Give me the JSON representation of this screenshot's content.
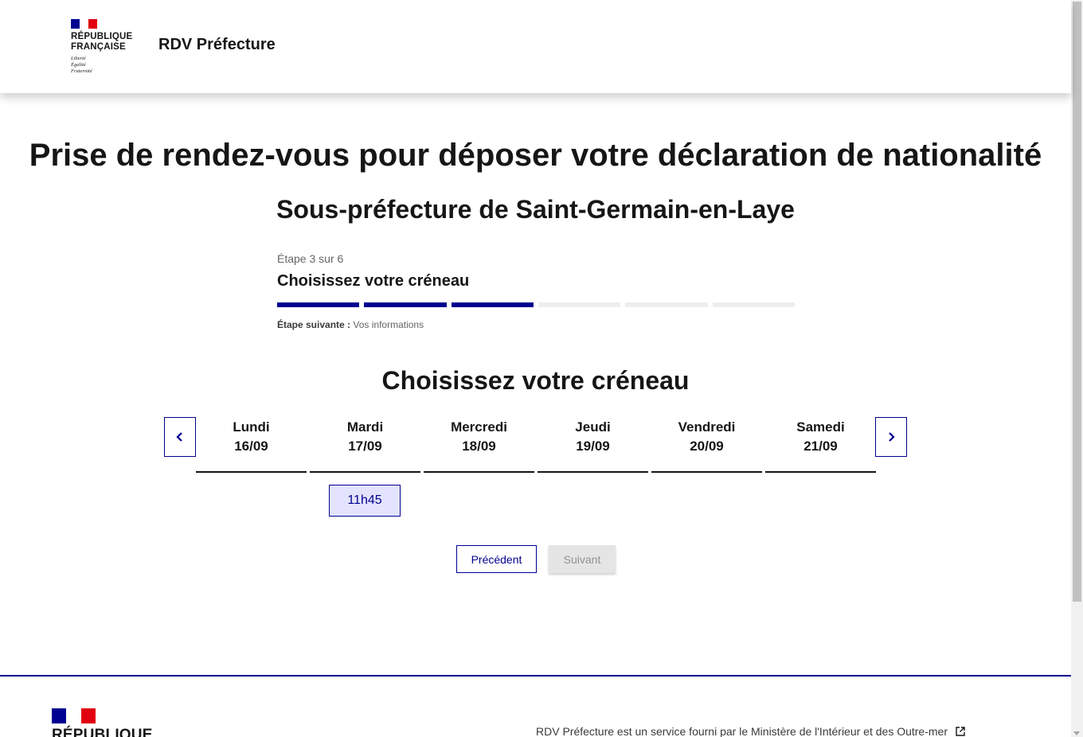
{
  "header": {
    "logo_text": "RÉPUBLIQUE\nFRANÇAISE",
    "devise": "Liberté\nÉgalité\nFraternité",
    "site_title": "RDV Préfecture"
  },
  "main": {
    "title": "Prise de rendez-vous pour déposer votre déclaration de nationalité",
    "subtitle": "Sous-préfecture de Saint-Germain-en-Laye",
    "stepper": {
      "state": "Étape 3 sur 6",
      "title": "Choisissez votre créneau",
      "total_steps": 6,
      "current_step": 3,
      "next_label": "Étape suivante :",
      "next_value": "Vos informations"
    },
    "section_title": "Choisissez votre créneau",
    "days": [
      {
        "name": "Lundi",
        "date": "16/09"
      },
      {
        "name": "Mardi",
        "date": "17/09"
      },
      {
        "name": "Mercredi",
        "date": "18/09"
      },
      {
        "name": "Jeudi",
        "date": "19/09"
      },
      {
        "name": "Vendredi",
        "date": "20/09"
      },
      {
        "name": "Samedi",
        "date": "21/09"
      }
    ],
    "slot": "11h45",
    "prev_button": "Précédent",
    "next_button": "Suivant"
  },
  "footer": {
    "logo_text": "RÉPUBLIQUE",
    "text": "RDV Préfecture est un service fourni par le Ministère de l'Intérieur et des Outre-mer"
  },
  "colors": {
    "primary": "#000091",
    "slot_bg": "#e3e3fd",
    "red": "#e1000f"
  }
}
